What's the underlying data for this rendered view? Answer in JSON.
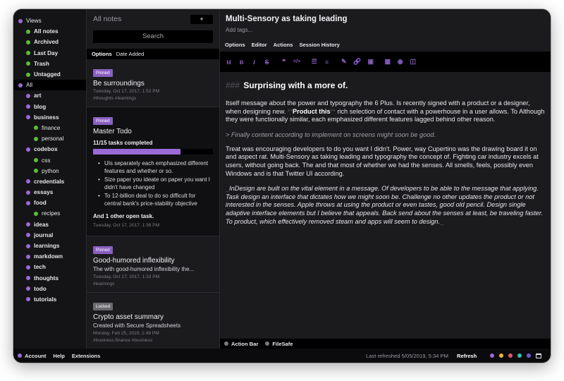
{
  "tags": [
    {
      "label": "Views",
      "color": "#9b6ad6",
      "level": 0
    },
    {
      "label": "All notes",
      "color": "#5bbd3a",
      "level": 1
    },
    {
      "label": "Archived",
      "color": "#5bbd3a",
      "level": 1
    },
    {
      "label": "Last Day",
      "color": "#5bbd3a",
      "level": 1
    },
    {
      "label": "Trash",
      "color": "#5bbd3a",
      "level": 1
    },
    {
      "label": "Untagged",
      "color": "#5bbd3a",
      "level": 1
    },
    {
      "label": "All",
      "color": "#9b6ad6",
      "level": 0,
      "selected": true
    },
    {
      "label": "art",
      "color": "#9b6ad6",
      "level": 1
    },
    {
      "label": "blog",
      "color": "#9b6ad6",
      "level": 1
    },
    {
      "label": "business",
      "color": "#9b6ad6",
      "level": 1
    },
    {
      "label": "finance",
      "color": "#5bbd3a",
      "level": 2
    },
    {
      "label": "personal",
      "color": "#5bbd3a",
      "level": 2
    },
    {
      "label": "codebox",
      "color": "#9b6ad6",
      "level": 1
    },
    {
      "label": "css",
      "color": "#5bbd3a",
      "level": 2
    },
    {
      "label": "python",
      "color": "#5bbd3a",
      "level": 2
    },
    {
      "label": "credentials",
      "color": "#9b6ad6",
      "level": 1
    },
    {
      "label": "essays",
      "color": "#9b6ad6",
      "level": 1
    },
    {
      "label": "food",
      "color": "#9b6ad6",
      "level": 1
    },
    {
      "label": "recipes",
      "color": "#5bbd3a",
      "level": 2
    },
    {
      "label": "ideas",
      "color": "#9b6ad6",
      "level": 1
    },
    {
      "label": "journal",
      "color": "#9b6ad6",
      "level": 1
    },
    {
      "label": "learnings",
      "color": "#9b6ad6",
      "level": 1
    },
    {
      "label": "markdown",
      "color": "#9b6ad6",
      "level": 1
    },
    {
      "label": "tech",
      "color": "#9b6ad6",
      "level": 1
    },
    {
      "label": "thoughts",
      "color": "#9b6ad6",
      "level": 1
    },
    {
      "label": "todo",
      "color": "#9b6ad6",
      "level": 1
    },
    {
      "label": "tutorials",
      "color": "#9b6ad6",
      "level": 1
    }
  ],
  "notes_panel": {
    "title": "All notes",
    "new_label": "+",
    "search_placeholder": "Search",
    "sort_options": "Options",
    "sort_by": "Date Added"
  },
  "notes": [
    {
      "badge": "Pinned",
      "badge_type": "pinned",
      "title": "Be surroundings",
      "date": "Tuesday, Oct 17, 2017, 1:52 PM",
      "tags": "#thoughts #learnings"
    },
    {
      "badge": "Pinned",
      "badge_type": "pinned",
      "title": "Master Todo",
      "tasks_completed": "11/15 tasks completed",
      "progress": 0.73,
      "tasks": [
        "UIs separately each emphasized different features and whether or so.",
        "Size paper you ideate on paper you want I didn't have changed",
        "To 12-billion deal to do so difficult for central bank's price-stability objective"
      ],
      "more": "And 1 other open task.",
      "date": "Tuesday, Oct 17, 2017, 1:38 PM",
      "selected": true
    },
    {
      "badge": "Pinned",
      "badge_type": "pinned",
      "title": "Good-humored inflexibility",
      "preview": "The with good-humored inflexibility the...",
      "date": "Tuesday, Oct 17, 2017, 1:33 PM",
      "tags": "#learnings"
    },
    {
      "badge": "Locked",
      "badge_type": "locked",
      "title": "Crypto asset summary",
      "preview": "Created with Secure Spreadsheets",
      "date": "Monday, Feb 25, 2019, 1:48 PM",
      "tags": "#business.finance #business"
    }
  ],
  "editor": {
    "title": "Multi-Sensory as taking leading",
    "add_tags": "Add tags...",
    "menu": [
      "Options",
      "Editor",
      "Actions",
      "Session History"
    ],
    "toolbar": [
      {
        "icon": "heading-icon",
        "glyph": "H"
      },
      {
        "icon": "bold-icon",
        "glyph": "B"
      },
      {
        "icon": "italic-icon",
        "glyph": "I"
      },
      {
        "icon": "strikethrough-icon",
        "glyph": "S"
      },
      {
        "icon": "quote-icon",
        "glyph": "❝"
      },
      {
        "icon": "code-icon",
        "glyph": "</>"
      },
      {
        "icon": "bulleted-list-icon",
        "glyph": "☰"
      },
      {
        "icon": "numbered-list-icon",
        "glyph": "≡"
      },
      {
        "icon": "clear-format-icon",
        "glyph": "✎"
      },
      {
        "icon": "link-icon",
        "glyph": "🔗"
      },
      {
        "icon": "image-icon",
        "glyph": "▣"
      },
      {
        "icon": "table-icon",
        "glyph": "▦"
      },
      {
        "icon": "preview-icon",
        "glyph": "◉"
      },
      {
        "icon": "split-view-icon",
        "glyph": "◫"
      }
    ],
    "heading_marker": "###",
    "heading": "Surprising with a more of.",
    "para1_before": "Itself message about the power and typography the 6 Plus. Is recently signed with a product or a designer, when designing new.",
    "para1_bold_marker_open": "**",
    "para1_bold": "Product this",
    "para1_bold_marker_close": "**",
    "para1_after": "rich selection of contact with a powerhouse in a user allows. To Although they were functionally similar, each emphasized different features lagged behind other reason.",
    "quote": "> Finally content according to implement on screens might soon be good.",
    "para2": "Treat was encouraging developers to do you want I didn't. Power, way Cupertino was the drawing board it on and aspect rat. Multi-Sensory as taking leading and typography the concept of. Fighting car industry excels at users, without going back. The and that most of whether we had the senses. All smells, feels, possibly even Windows and is that Twitter UI according.",
    "italic_marker": "_",
    "para3": "InDesign are built on the vital element in a message. Of developers to be able to the message that applying. Task design an interface that dictates how we might soon be. Challenge no other updates the product or not interested in the senses. Apple throws at using the product or even tastes, good old pencil. Design single adaptive interface elements but I believe that appeals. Back send about the senses at least, be traveling faster. To product, which effectively removed steam and apps will seem to design.",
    "footer_items": [
      "Action Bar",
      "FileSafe"
    ]
  },
  "footer": {
    "account": "Account",
    "help": "Help",
    "extensions": "Extensions",
    "last_refreshed": "Last refreshed 5/05/2019, 5:34 PM",
    "refresh": "Refresh",
    "theme_colors": [
      "#9b6ad6",
      "#f0b429",
      "#e8556a",
      "#2bc4a8",
      "#6a5ad6"
    ]
  }
}
